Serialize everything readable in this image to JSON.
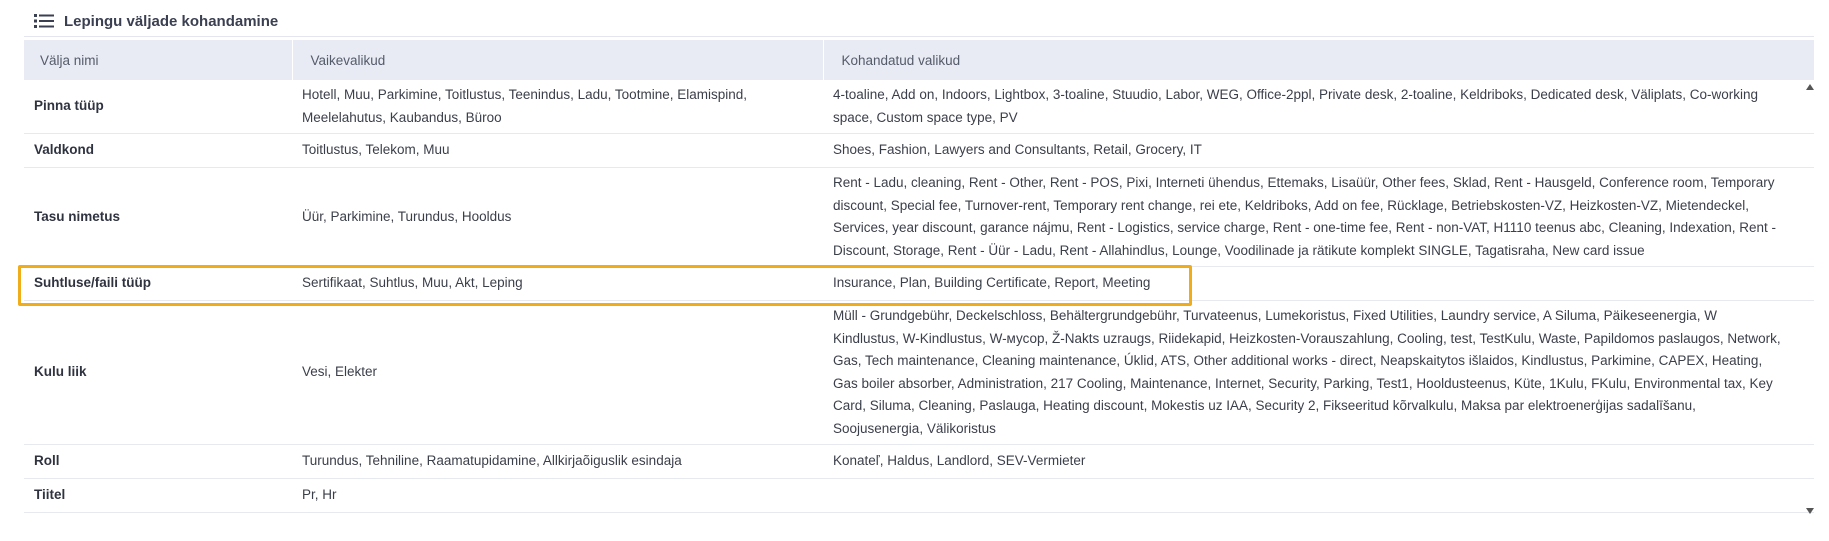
{
  "panel": {
    "title": "Lepingu väljade kohandamine",
    "icon": "list-icon"
  },
  "table": {
    "headers": [
      "Välja nimi",
      "Vaikevalikud",
      "Kohandatud valikud"
    ],
    "rows": [
      {
        "name": "Pinna tüüp",
        "default": "Hotell, Muu, Parkimine, Toitlustus, Teenindus, Ladu, Tootmine, Elamispind, Meelelahutus, Kaubandus, Büroo",
        "custom": "4-toaline, Add on, Indoors, Lightbox, 3-toaline, Stuudio, Labor, WEG, Office-2ppl, Private desk, 2-toaline, Keldriboks, Dedicated desk, Väliplats, Co-working space, Custom space type, PV"
      },
      {
        "name": "Valdkond",
        "default": "Toitlustus, Telekom, Muu",
        "custom": "Shoes, Fashion, Lawyers and Consultants, Retail, Grocery, IT"
      },
      {
        "name": "Tasu nimetus",
        "default": "Üür, Parkimine, Turundus, Hooldus",
        "custom": "Rent - Ladu, cleaning, Rent - Other, Rent - POS, Pixi, Interneti ühendus, Ettemaks, Lisaüür, Other fees, Sklad, Rent - Hausgeld, Conference room, Temporary discount, Special fee, Turnover-rent, Temporary rent change, rei ete, Keldriboks, Add on fee, Rücklage, Betriebskosten-VZ, Heizkosten-VZ, Mietendeckel, Services, year discount, garance nájmu, Rent - Logistics, service charge, Rent - one-time fee, Rent - non-VAT, H1110 teenus abc, Cleaning, Indexation, Rent - Discount, Storage, Rent - Üür - Ladu, Rent - Allahindlus, Lounge, Voodilinade ja rätikute komplekt SINGLE, Tagatisraha, New card issue"
      },
      {
        "name": "Suhtluse/faili tüüp",
        "default": "Sertifikaat, Suhtlus, Muu, Akt, Leping",
        "custom": "Insurance, Plan, Building Certificate, Report, Meeting"
      },
      {
        "name": "Kulu liik",
        "default": "Vesi, Elekter",
        "custom": "Müll - Grundgebühr, Deckelschloss, Behältergrundgebühr, Turvateenus, Lumekoristus, Fixed Utilities, Laundry service, A Siluma, Päikeseenergia, W Kindlustus, W-Kindlustus, W-мусор, Ž-Nakts uzraugs, Riidekapid, Heizkosten-Vorauszahlung, Cooling, test, TestKulu, Waste, Papildomos paslaugos, Network, Gas, Tech maintenance, Cleaning maintenance, Úklid, ATS, Other additional works - direct, Neapskaitytos išlaidos, Kindlustus, Parkimine, CAPEX, Heating, Gas boiler absorber, Administration, 217 Cooling, Maintenance, Internet, Security, Parking, Test1, Hooldusteenus, Küte, 1Kulu, FKulu, Environmental tax, Key Card, Siluma, Cleaning, Paslauga, Heating discount, Mokestis uz IAA, Security 2, Fikseeritud kõrvalkulu, Maksa par elektroenerģijas sadalīšanu, Soojusenergia, Välikoristus"
      },
      {
        "name": "Roll",
        "default": "Turundus, Tehniline, Raamatupidamine, Allkirjaõiguslik esindaja",
        "custom": "Konateľ, Haldus, Landlord, SEV-Vermieter"
      },
      {
        "name": "Tiitel",
        "default": "Pr, Hr",
        "custom": ""
      }
    ]
  },
  "highlight": {
    "row": "Suhtluse/faili tüüp",
    "color": "#f0ad1b"
  },
  "scrollbar": {
    "up_icon": "scroll-up-icon",
    "down_icon": "scroll-down-icon"
  }
}
